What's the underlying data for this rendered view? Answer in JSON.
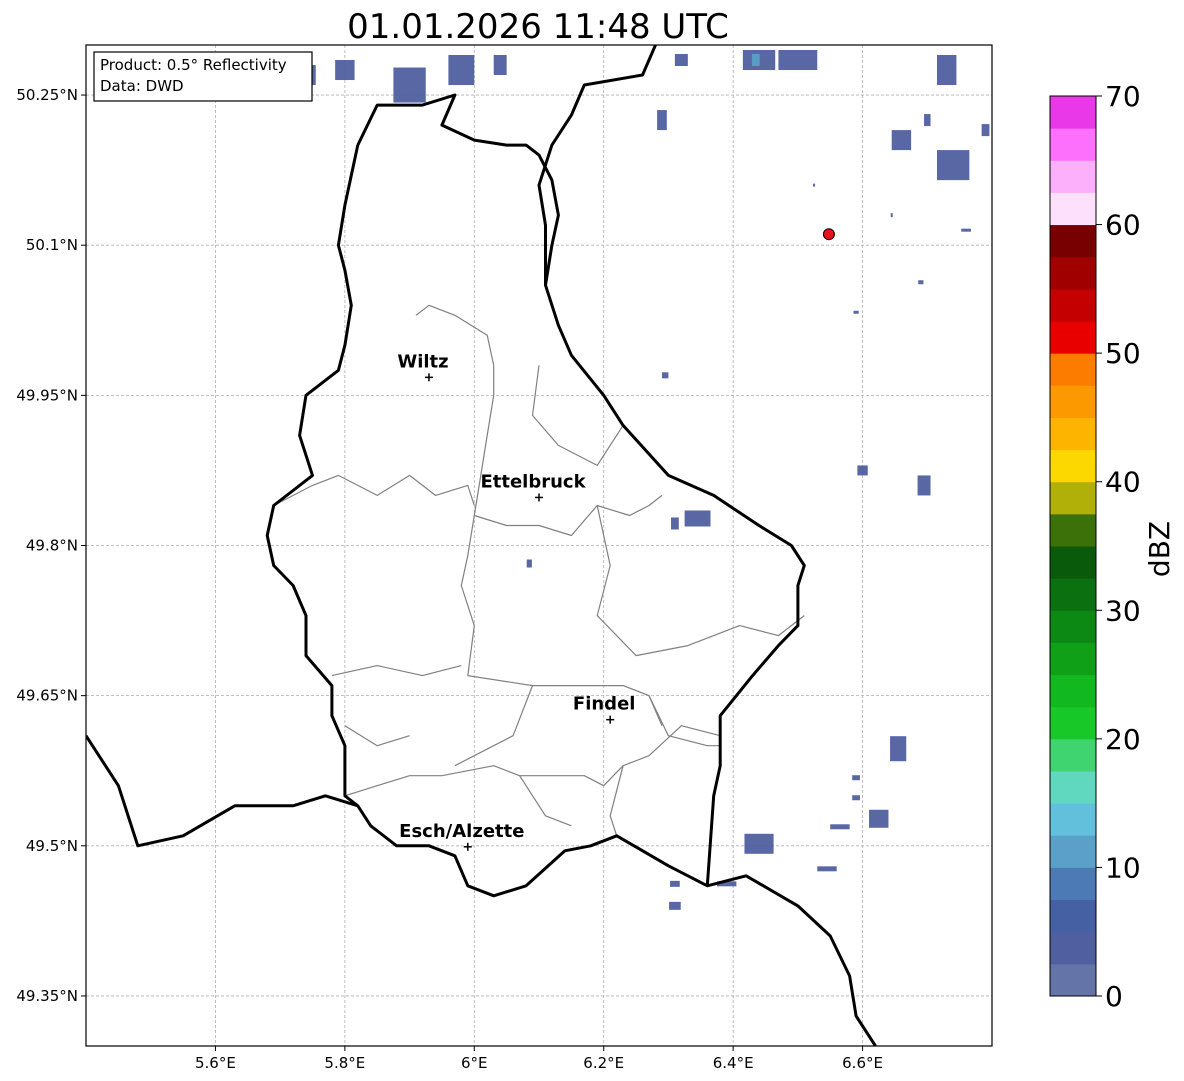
{
  "title": "01.01.2026 11:48 UTC",
  "info_box": {
    "product": "Product: 0.5° Reflectivity",
    "source": "Data: DWD"
  },
  "axes": {
    "lon_ticks": [
      {
        "value": 5.6,
        "label": "5.6°E"
      },
      {
        "value": 5.8,
        "label": "5.8°E"
      },
      {
        "value": 6.0,
        "label": "6°E"
      },
      {
        "value": 6.2,
        "label": "6.2°E"
      },
      {
        "value": 6.4,
        "label": "6.4°E"
      },
      {
        "value": 6.6,
        "label": "6.6°E"
      }
    ],
    "lat_ticks": [
      {
        "value": 50.25,
        "label": "50.25°N"
      },
      {
        "value": 50.1,
        "label": "50.1°N"
      },
      {
        "value": 49.95,
        "label": "49.95°N"
      },
      {
        "value": 49.8,
        "label": "49.8°N"
      },
      {
        "value": 49.65,
        "label": "49.65°N"
      },
      {
        "value": 49.5,
        "label": "49.5°N"
      },
      {
        "value": 49.35,
        "label": "49.35°N"
      }
    ],
    "lon_range": [
      5.4,
      6.8
    ],
    "lat_range": [
      49.3,
      50.3
    ],
    "grid": true
  },
  "cities": [
    {
      "name": "Wiltz",
      "lon": 5.93,
      "lat": 49.968
    },
    {
      "name": "Ettelbruck",
      "lon": 6.1,
      "lat": 49.848
    },
    {
      "name": "Findel",
      "lon": 6.21,
      "lat": 49.626
    },
    {
      "name": "Esch/Alzette",
      "lon": 5.99,
      "lat": 49.499
    }
  ],
  "radar_site": {
    "lon": 6.548,
    "lat": 50.111,
    "color": "#e8101a"
  },
  "colorbar": {
    "label": "dBZ",
    "min": 0,
    "max": 70,
    "ticks": [
      {
        "value": 0,
        "label": "0"
      },
      {
        "value": 10,
        "label": "10"
      },
      {
        "value": 20,
        "label": "20"
      },
      {
        "value": 30,
        "label": "30"
      },
      {
        "value": 40,
        "label": "40"
      },
      {
        "value": 50,
        "label": "50"
      },
      {
        "value": 60,
        "label": "60"
      },
      {
        "value": 70,
        "label": "70"
      }
    ],
    "colors": [
      "#6474a8",
      "#505fa0",
      "#4660a4",
      "#4c7ab4",
      "#5aa0c8",
      "#62c0dc",
      "#60d8c0",
      "#40d470",
      "#18c828",
      "#12b820",
      "#10a018",
      "#0c8814",
      "#0a7010",
      "#0a5a0c",
      "#3c7008",
      "#b0b008",
      "#fcd800",
      "#fcb400",
      "#fc9800",
      "#fc7c00",
      "#e80000",
      "#c40000",
      "#a00000",
      "#780000",
      "#fce0fc",
      "#fcb0fc",
      "#fc70fc",
      "#e838e8"
    ]
  },
  "echoes": [
    {
      "lon": 5.73,
      "lat": 50.27,
      "w": 0.05,
      "h": 0.02,
      "dbz": 3
    },
    {
      "lon": 5.8,
      "lat": 50.275,
      "w": 0.03,
      "h": 0.02,
      "dbz": 3
    },
    {
      "lon": 5.9,
      "lat": 50.26,
      "w": 0.05,
      "h": 0.035,
      "dbz": 3
    },
    {
      "lon": 5.98,
      "lat": 50.275,
      "w": 0.04,
      "h": 0.03,
      "dbz": 3
    },
    {
      "lon": 6.04,
      "lat": 50.28,
      "w": 0.02,
      "h": 0.02,
      "dbz": 3
    },
    {
      "lon": 6.44,
      "lat": 50.285,
      "w": 0.05,
      "h": 0.02,
      "dbz": 4
    },
    {
      "lon": 6.435,
      "lat": 50.285,
      "w": 0.012,
      "h": 0.012,
      "dbz": 12
    },
    {
      "lon": 6.5,
      "lat": 50.285,
      "w": 0.06,
      "h": 0.02,
      "dbz": 3
    },
    {
      "lon": 6.32,
      "lat": 50.285,
      "w": 0.02,
      "h": 0.012,
      "dbz": 3
    },
    {
      "lon": 6.29,
      "lat": 50.225,
      "w": 0.015,
      "h": 0.02,
      "dbz": 3
    },
    {
      "lon": 6.73,
      "lat": 50.275,
      "w": 0.03,
      "h": 0.03,
      "dbz": 3
    },
    {
      "lon": 6.66,
      "lat": 50.205,
      "w": 0.03,
      "h": 0.02,
      "dbz": 3
    },
    {
      "lon": 6.74,
      "lat": 50.18,
      "w": 0.05,
      "h": 0.03,
      "dbz": 3
    },
    {
      "lon": 6.79,
      "lat": 50.215,
      "w": 0.012,
      "h": 0.012,
      "dbz": 3
    },
    {
      "lon": 6.7,
      "lat": 50.225,
      "w": 0.01,
      "h": 0.012,
      "dbz": 3
    },
    {
      "lon": 6.295,
      "lat": 49.97,
      "w": 0.01,
      "h": 0.006,
      "dbz": 3
    },
    {
      "lon": 6.6,
      "lat": 49.875,
      "w": 0.016,
      "h": 0.01,
      "dbz": 3
    },
    {
      "lon": 6.695,
      "lat": 49.86,
      "w": 0.02,
      "h": 0.02,
      "dbz": 3
    },
    {
      "lon": 6.345,
      "lat": 49.827,
      "w": 0.04,
      "h": 0.016,
      "dbz": 3
    },
    {
      "lon": 6.31,
      "lat": 49.822,
      "w": 0.012,
      "h": 0.012,
      "dbz": 3
    },
    {
      "lon": 6.085,
      "lat": 49.782,
      "w": 0.008,
      "h": 0.008,
      "dbz": 3
    },
    {
      "lon": 6.655,
      "lat": 49.597,
      "w": 0.025,
      "h": 0.025,
      "dbz": 3
    },
    {
      "lon": 6.59,
      "lat": 49.568,
      "w": 0.012,
      "h": 0.005,
      "dbz": 3
    },
    {
      "lon": 6.59,
      "lat": 49.548,
      "w": 0.012,
      "h": 0.005,
      "dbz": 3
    },
    {
      "lon": 6.625,
      "lat": 49.527,
      "w": 0.03,
      "h": 0.018,
      "dbz": 3
    },
    {
      "lon": 6.565,
      "lat": 49.519,
      "w": 0.03,
      "h": 0.005,
      "dbz": 3
    },
    {
      "lon": 6.44,
      "lat": 49.502,
      "w": 0.045,
      "h": 0.02,
      "dbz": 3
    },
    {
      "lon": 6.545,
      "lat": 49.477,
      "w": 0.03,
      "h": 0.005,
      "dbz": 3
    },
    {
      "lon": 6.31,
      "lat": 49.462,
      "w": 0.015,
      "h": 0.006,
      "dbz": 3
    },
    {
      "lon": 6.39,
      "lat": 49.462,
      "w": 0.03,
      "h": 0.005,
      "dbz": 3
    },
    {
      "lon": 6.31,
      "lat": 49.44,
      "w": 0.018,
      "h": 0.008,
      "dbz": 3
    },
    {
      "lon": 6.525,
      "lat": 50.16,
      "w": 0.003,
      "h": 0.003,
      "dbz": 3
    },
    {
      "lon": 6.76,
      "lat": 50.115,
      "w": 0.015,
      "h": 0.003,
      "dbz": 3
    },
    {
      "lon": 6.59,
      "lat": 50.033,
      "w": 0.008,
      "h": 0.003,
      "dbz": 3
    },
    {
      "lon": 6.69,
      "lat": 50.063,
      "w": 0.008,
      "h": 0.004,
      "dbz": 3
    },
    {
      "lon": 6.645,
      "lat": 50.13,
      "w": 0.003,
      "h": 0.004,
      "dbz": 3
    }
  ],
  "borders": {
    "luxembourg": [
      [
        5.82,
        50.2
      ],
      [
        5.85,
        50.24
      ],
      [
        5.92,
        50.24
      ],
      [
        5.97,
        50.25
      ],
      [
        5.95,
        50.22
      ],
      [
        6.0,
        50.205
      ],
      [
        6.05,
        50.2
      ],
      [
        6.08,
        50.2
      ],
      [
        6.1,
        50.19
      ],
      [
        6.12,
        50.165
      ],
      [
        6.13,
        50.13
      ],
      [
        6.12,
        50.1
      ],
      [
        6.11,
        50.06
      ],
      [
        6.13,
        50.02
      ],
      [
        6.15,
        49.99
      ],
      [
        6.2,
        49.95
      ],
      [
        6.23,
        49.92
      ],
      [
        6.3,
        49.87
      ],
      [
        6.37,
        49.85
      ],
      [
        6.44,
        49.82
      ],
      [
        6.49,
        49.8
      ],
      [
        6.51,
        49.78
      ],
      [
        6.5,
        49.76
      ],
      [
        6.5,
        49.72
      ],
      [
        6.47,
        49.7
      ],
      [
        6.43,
        49.67
      ],
      [
        6.38,
        49.63
      ],
      [
        6.38,
        49.58
      ],
      [
        6.37,
        49.55
      ],
      [
        6.36,
        49.46
      ],
      [
        6.3,
        49.48
      ],
      [
        6.22,
        49.51
      ],
      [
        6.18,
        49.5
      ],
      [
        6.14,
        49.495
      ],
      [
        6.08,
        49.46
      ],
      [
        6.03,
        49.45
      ],
      [
        5.99,
        49.46
      ],
      [
        5.97,
        49.49
      ],
      [
        5.93,
        49.5
      ],
      [
        5.88,
        49.5
      ],
      [
        5.84,
        49.52
      ],
      [
        5.82,
        49.54
      ],
      [
        5.8,
        49.55
      ],
      [
        5.8,
        49.6
      ],
      [
        5.78,
        49.63
      ],
      [
        5.78,
        49.66
      ],
      [
        5.74,
        49.69
      ],
      [
        5.74,
        49.73
      ],
      [
        5.72,
        49.76
      ],
      [
        5.69,
        49.78
      ],
      [
        5.68,
        49.81
      ],
      [
        5.69,
        49.84
      ],
      [
        5.75,
        49.87
      ],
      [
        5.73,
        49.91
      ],
      [
        5.74,
        49.95
      ],
      [
        5.76,
        49.96
      ],
      [
        5.79,
        49.975
      ],
      [
        5.8,
        50.0
      ],
      [
        5.81,
        50.04
      ],
      [
        5.8,
        50.075
      ],
      [
        5.79,
        50.1
      ],
      [
        5.8,
        50.14
      ],
      [
        5.82,
        50.2
      ]
    ],
    "germany_belgium": [
      [
        6.11,
        50.06
      ],
      [
        6.11,
        50.12
      ],
      [
        6.1,
        50.16
      ],
      [
        6.12,
        50.2
      ],
      [
        6.15,
        50.23
      ],
      [
        6.17,
        50.26
      ],
      [
        6.26,
        50.27
      ],
      [
        6.28,
        50.3
      ]
    ],
    "france_belgium": [
      [
        5.4,
        49.61
      ],
      [
        5.45,
        49.56
      ],
      [
        5.48,
        49.5
      ],
      [
        5.55,
        49.51
      ],
      [
        5.63,
        49.54
      ],
      [
        5.72,
        49.54
      ],
      [
        5.77,
        49.55
      ],
      [
        5.82,
        49.54
      ]
    ],
    "france_germany": [
      [
        6.36,
        49.46
      ],
      [
        6.42,
        49.47
      ],
      [
        6.5,
        49.44
      ],
      [
        6.55,
        49.41
      ],
      [
        6.58,
        49.37
      ],
      [
        6.59,
        49.33
      ],
      [
        6.62,
        49.3
      ]
    ]
  },
  "cantons": [
    [
      [
        5.91,
        50.03
      ],
      [
        5.93,
        50.04
      ],
      [
        5.97,
        50.03
      ],
      [
        6.02,
        50.01
      ],
      [
        6.03,
        49.98
      ]
    ],
    [
      [
        5.69,
        49.84
      ],
      [
        5.75,
        49.86
      ],
      [
        5.79,
        49.87
      ],
      [
        5.85,
        49.85
      ],
      [
        5.9,
        49.87
      ],
      [
        5.94,
        49.85
      ],
      [
        5.99,
        49.86
      ],
      [
        6.0,
        49.84
      ]
    ],
    [
      [
        6.03,
        49.98
      ],
      [
        6.03,
        49.95
      ],
      [
        6.02,
        49.91
      ],
      [
        6.01,
        49.87
      ],
      [
        6.0,
        49.83
      ],
      [
        6.05,
        49.82
      ],
      [
        6.1,
        49.82
      ],
      [
        6.15,
        49.81
      ],
      [
        6.19,
        49.84
      ],
      [
        6.24,
        49.83
      ],
      [
        6.27,
        49.84
      ],
      [
        6.29,
        49.85
      ]
    ],
    [
      [
        6.1,
        49.98
      ],
      [
        6.09,
        49.93
      ],
      [
        6.13,
        49.9
      ],
      [
        6.19,
        49.88
      ],
      [
        6.23,
        49.92
      ]
    ],
    [
      [
        6.0,
        49.83
      ],
      [
        5.99,
        49.79
      ],
      [
        5.98,
        49.76
      ],
      [
        6.0,
        49.72
      ],
      [
        5.99,
        49.67
      ],
      [
        6.09,
        49.66
      ],
      [
        6.17,
        49.66
      ],
      [
        6.23,
        49.66
      ],
      [
        6.27,
        49.65
      ],
      [
        6.29,
        49.62
      ]
    ],
    [
      [
        6.19,
        49.84
      ],
      [
        6.21,
        49.78
      ],
      [
        6.19,
        49.73
      ],
      [
        6.25,
        49.69
      ],
      [
        6.33,
        49.7
      ],
      [
        6.41,
        49.72
      ],
      [
        6.47,
        49.71
      ],
      [
        6.51,
        49.73
      ]
    ],
    [
      [
        5.78,
        49.67
      ],
      [
        5.85,
        49.68
      ],
      [
        5.92,
        49.67
      ],
      [
        5.98,
        49.68
      ]
    ],
    [
      [
        6.09,
        49.66
      ],
      [
        6.06,
        49.61
      ],
      [
        6.0,
        49.59
      ],
      [
        5.97,
        49.58
      ]
    ],
    [
      [
        5.8,
        49.55
      ],
      [
        5.85,
        49.56
      ],
      [
        5.9,
        49.57
      ],
      [
        5.95,
        49.57
      ],
      [
        6.03,
        49.58
      ],
      [
        6.07,
        49.57
      ],
      [
        6.12,
        49.57
      ],
      [
        6.17,
        49.57
      ],
      [
        6.2,
        49.56
      ],
      [
        6.23,
        49.58
      ],
      [
        6.27,
        49.59
      ],
      [
        6.32,
        49.62
      ],
      [
        6.38,
        49.61
      ]
    ],
    [
      [
        6.23,
        49.58
      ],
      [
        6.21,
        49.53
      ],
      [
        6.22,
        49.51
      ]
    ],
    [
      [
        6.27,
        49.65
      ],
      [
        6.3,
        49.61
      ],
      [
        6.36,
        49.6
      ],
      [
        6.38,
        49.6
      ]
    ],
    [
      [
        5.8,
        49.62
      ],
      [
        5.85,
        49.6
      ],
      [
        5.9,
        49.61
      ]
    ],
    [
      [
        6.07,
        49.57
      ],
      [
        6.11,
        49.53
      ],
      [
        6.15,
        49.52
      ]
    ]
  ]
}
